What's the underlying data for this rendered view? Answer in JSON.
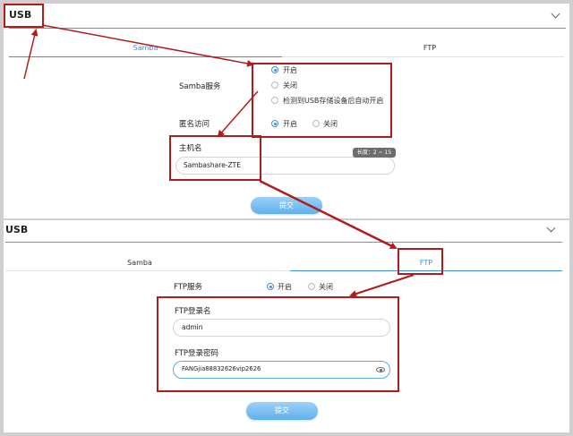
{
  "top": {
    "title": "USB",
    "tabs": [
      "Samba",
      "FTP"
    ],
    "samba_service_label": "Samba服务",
    "samba_options": [
      "开启",
      "关闭",
      "检测到USB存储设备后自动开启"
    ],
    "anonymous_label": "匿名访问",
    "anonymous_options": [
      "开启",
      "关闭"
    ],
    "hostname_label": "主机名",
    "hostname_value": "Sambashare-ZTE",
    "tooltip": "长度：2 ~ 15",
    "submit": "提交"
  },
  "bottom": {
    "title": "USB",
    "tabs": [
      "Samba",
      "FTP"
    ],
    "ftp_service_label": "FTP服务",
    "ftp_options": [
      "开启",
      "关闭"
    ],
    "ftp_login_label": "FTP登录名",
    "ftp_login_value": "admin",
    "ftp_password_label": "FTP登录密码",
    "ftp_password_value": "FANGjia88832626vip2626",
    "submit": "提交"
  },
  "colors": {
    "accent": "#3d8fe0",
    "annotation": "#b01c1c",
    "button": "#6cb6ef"
  }
}
